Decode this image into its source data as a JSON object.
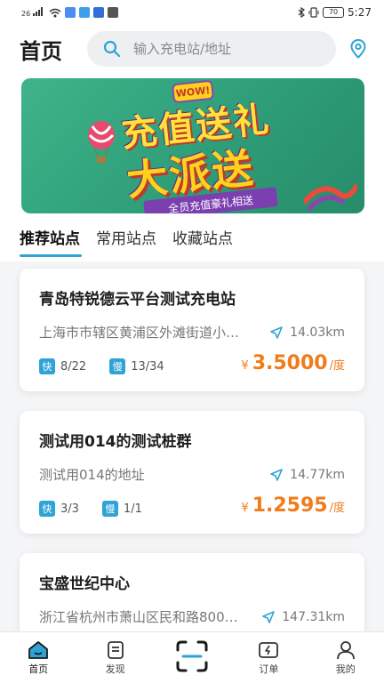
{
  "status_bar": {
    "signal": "26",
    "battery": "70",
    "time": "5:27"
  },
  "header": {
    "title": "首页",
    "search": {
      "placeholder": "输入充电站/地址",
      "value": ""
    }
  },
  "banner": {
    "badge": "WOW!",
    "line1": "充值送礼",
    "line2": "大派送",
    "ribbon": "全员充值豪礼相送"
  },
  "tabs": [
    {
      "label": "推荐站点",
      "active": true
    },
    {
      "label": "常用站点",
      "active": false
    },
    {
      "label": "收藏站点",
      "active": false
    }
  ],
  "stations": [
    {
      "name": "青岛特锐德云平台测试充电站",
      "address": "上海市市辖区黄浦区外滩街道小…",
      "distance": "14.03km",
      "fast_label": "快",
      "fast": "8/22",
      "slow_label": "慢",
      "slow": "13/34",
      "currency": "¥",
      "price": "3.5000",
      "unit": "/度"
    },
    {
      "name": "测试用014的测试桩群",
      "address": "测试用014的地址",
      "distance": "14.77km",
      "fast_label": "快",
      "fast": "3/3",
      "slow_label": "慢",
      "slow": "1/1",
      "currency": "¥",
      "price": "1.2595",
      "unit": "/度"
    },
    {
      "name": "宝盛世纪中心",
      "address": "浙江省杭州市萧山区民和路800…",
      "distance": "147.31km"
    }
  ],
  "bottom_nav": [
    {
      "label": "首页",
      "icon": "home-icon",
      "active": true
    },
    {
      "label": "发现",
      "icon": "discover-icon",
      "active": false
    },
    {
      "label": "",
      "icon": "scan-icon",
      "active": false
    },
    {
      "label": "订单",
      "icon": "order-icon",
      "active": false
    },
    {
      "label": "我的",
      "icon": "profile-icon",
      "active": false
    }
  ],
  "colors": {
    "accent": "#2ea3d6",
    "price": "#f07c1b"
  }
}
